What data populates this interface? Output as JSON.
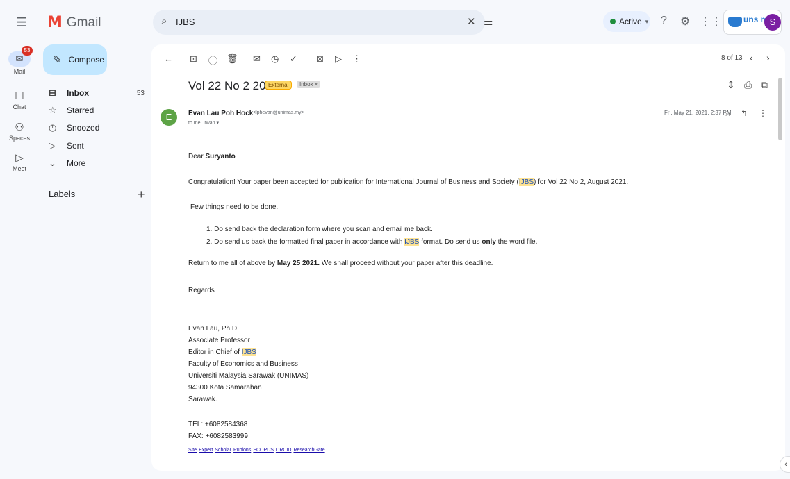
{
  "app": {
    "name": "Gmail"
  },
  "search": {
    "value": "IJBS"
  },
  "status": {
    "label": "Active"
  },
  "rail": {
    "mail": {
      "label": "Mail",
      "badge": "53"
    },
    "chat": {
      "label": "Chat"
    },
    "spaces": {
      "label": "Spaces"
    },
    "meet": {
      "label": "Meet"
    }
  },
  "compose": {
    "label": "Compose"
  },
  "nav": {
    "inbox": {
      "label": "Inbox",
      "count": "53"
    },
    "starred": {
      "label": "Starred"
    },
    "snoozed": {
      "label": "Snoozed"
    },
    "sent": {
      "label": "Sent"
    },
    "more": {
      "label": "More"
    }
  },
  "labels": {
    "heading": "Labels"
  },
  "account": {
    "brand": "uns mail",
    "initial": "S"
  },
  "toolbar": {
    "pager": "8 of 13"
  },
  "email": {
    "subject": "Vol 22 No 2 2021",
    "tag_external": "External",
    "tag_inbox": "Inbox ×",
    "sender_initial": "E",
    "sender_name": "Evan Lau Poh Hock",
    "sender_email": "<lphevan@unimas.my>",
    "recipients": "to me, Irwan ▾",
    "date": "Fri, May 21, 2021, 2:37 PM",
    "greeting_prefix": "Dear ",
    "greeting_name": "Suryanto",
    "line1_a": "Congratulation! Your paper been accepted for publication for International Journal of Business and Society (",
    "line1_hl": "IJBS",
    "line1_b": ") for Vol 22 No 2, August 2021.",
    "line2": "Few things need to be done.",
    "item1_num": "1.",
    "item1": "Do send back the declaration form where you scan and email me back.",
    "item2_num": "2.",
    "item2_a": "Do send us back the formatted final paper in accordance with ",
    "item2_hl": "IJBS",
    "item2_b": " format. Do send us ",
    "item2_bold": "only",
    "item2_c": " the word file.",
    "line3_a": "Return to me all of above by ",
    "line3_bold": "May 25 2021.",
    "line3_b": " We shall proceed without your paper after this deadline.",
    "regards": "Regards",
    "sig_name": "Evan Lau, Ph.D.",
    "sig_title": "Associate Professor",
    "sig_editor_a": "Editor in Chief of ",
    "sig_editor_hl": "IJBS",
    "sig_faculty": "Faculty of Economics and Business",
    "sig_uni": "Universiti Malaysia Sarawak (UNIMAS)",
    "sig_city": "94300 Kota Samarahan",
    "sig_state": "Sarawak.",
    "tel": "TEL: +6082584368",
    "fax": "FAX: +6082583999",
    "links": [
      "Site",
      "Expert",
      "Scholar",
      "Publons",
      "SCOPUS",
      "ORCID",
      "ResearchGate"
    ]
  }
}
